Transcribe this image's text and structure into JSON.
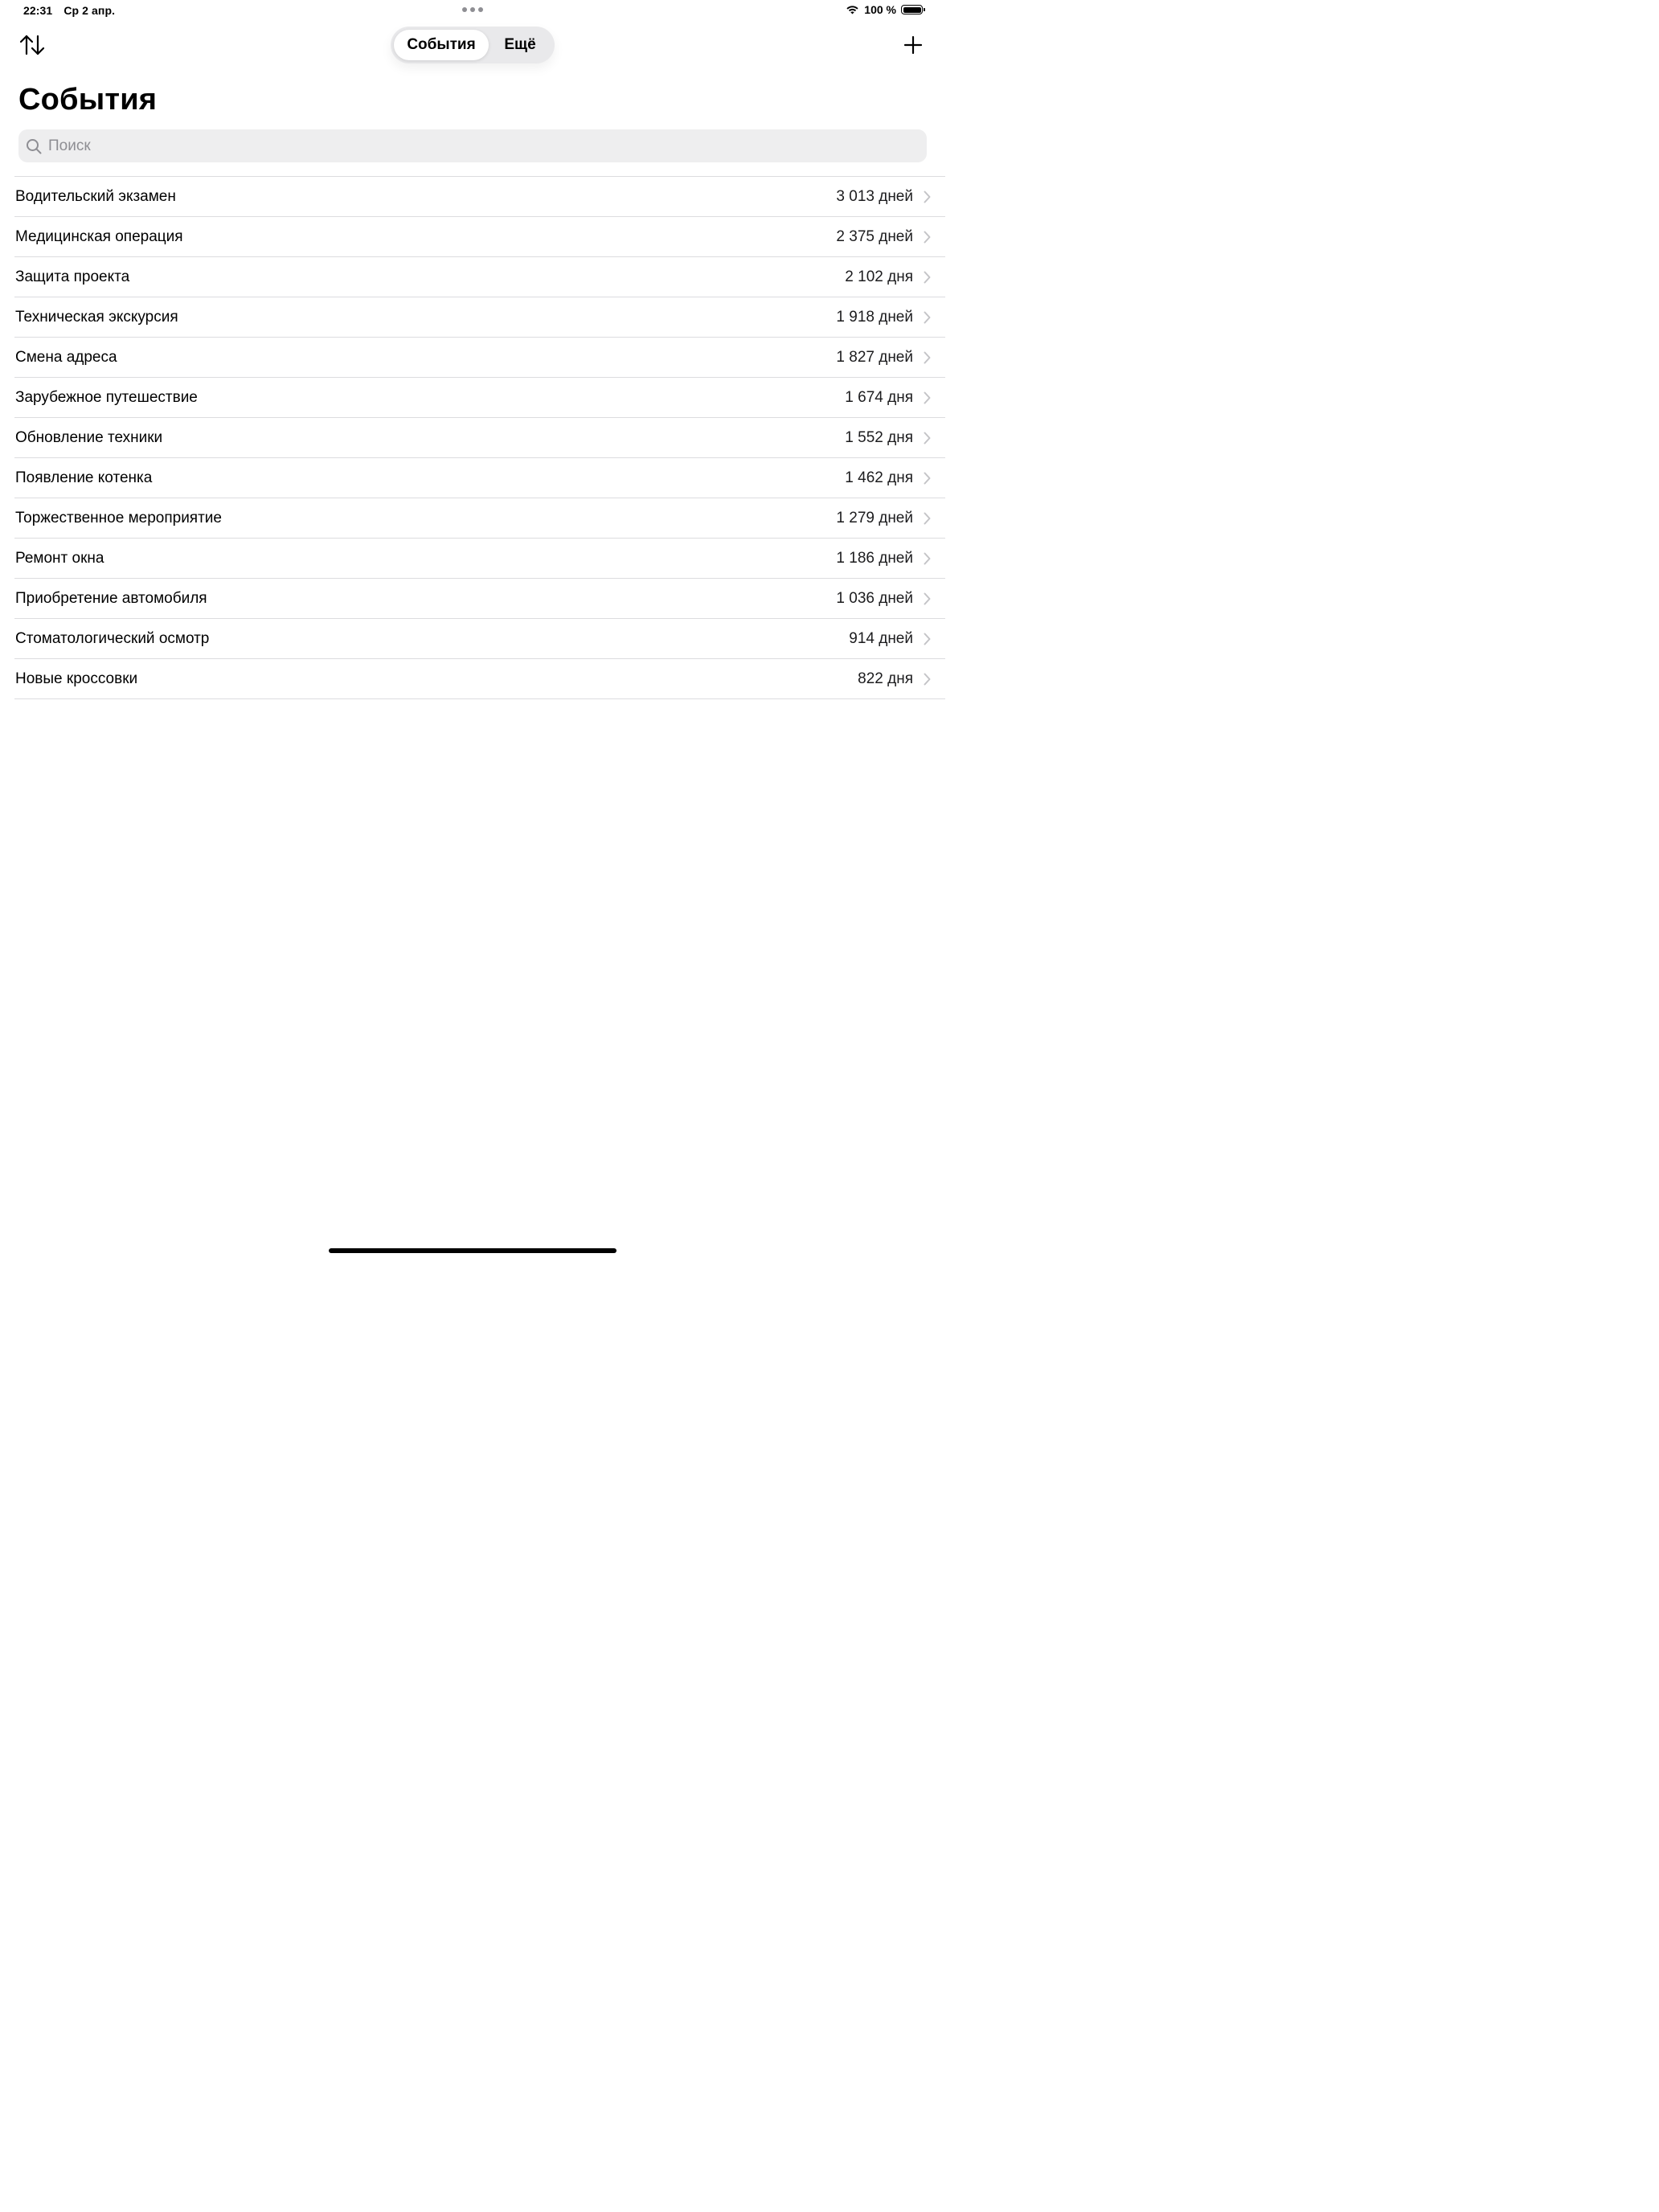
{
  "status_bar": {
    "time": "22:31",
    "date": "Ср 2 апр.",
    "battery_text": "100 %",
    "wifi_icon": "wifi-icon",
    "battery_icon": "battery-icon"
  },
  "nav": {
    "sort_icon": "arrow-up-down-icon",
    "add_icon": "plus-icon",
    "segments": [
      "События",
      "Ещё"
    ],
    "selected_segment": "События"
  },
  "title": "События",
  "search": {
    "placeholder": "Поиск",
    "value": "",
    "icon": "magnifying-glass-icon"
  },
  "events": [
    {
      "title": "Водительский экзамен",
      "value": "3 013 дней"
    },
    {
      "title": "Медицинская операция",
      "value": "2 375 дней"
    },
    {
      "title": "Защита проекта",
      "value": "2 102 дня"
    },
    {
      "title": "Техническая экскурсия",
      "value": "1 918 дней"
    },
    {
      "title": "Смена адреса",
      "value": "1 827 дней"
    },
    {
      "title": "Зарубежное путешествие",
      "value": "1 674 дня"
    },
    {
      "title": "Обновление техники",
      "value": "1 552 дня"
    },
    {
      "title": "Появление котенка",
      "value": "1 462 дня"
    },
    {
      "title": "Торжественное мероприятие",
      "value": "1 279 дней"
    },
    {
      "title": "Ремонт окна",
      "value": "1 186 дней"
    },
    {
      "title": "Приобретение автомобиля",
      "value": "1 036 дней"
    },
    {
      "title": "Стоматологический осмотр",
      "value": "914 дней"
    },
    {
      "title": "Новые кроссовки",
      "value": "822 дня"
    }
  ],
  "colors": {
    "separator": "#dcdcdf",
    "search_background": "#eeeeef",
    "segment_background": "#e9e9eb",
    "chevron": "#c4c4c7",
    "placeholder": "#8e8e93"
  }
}
